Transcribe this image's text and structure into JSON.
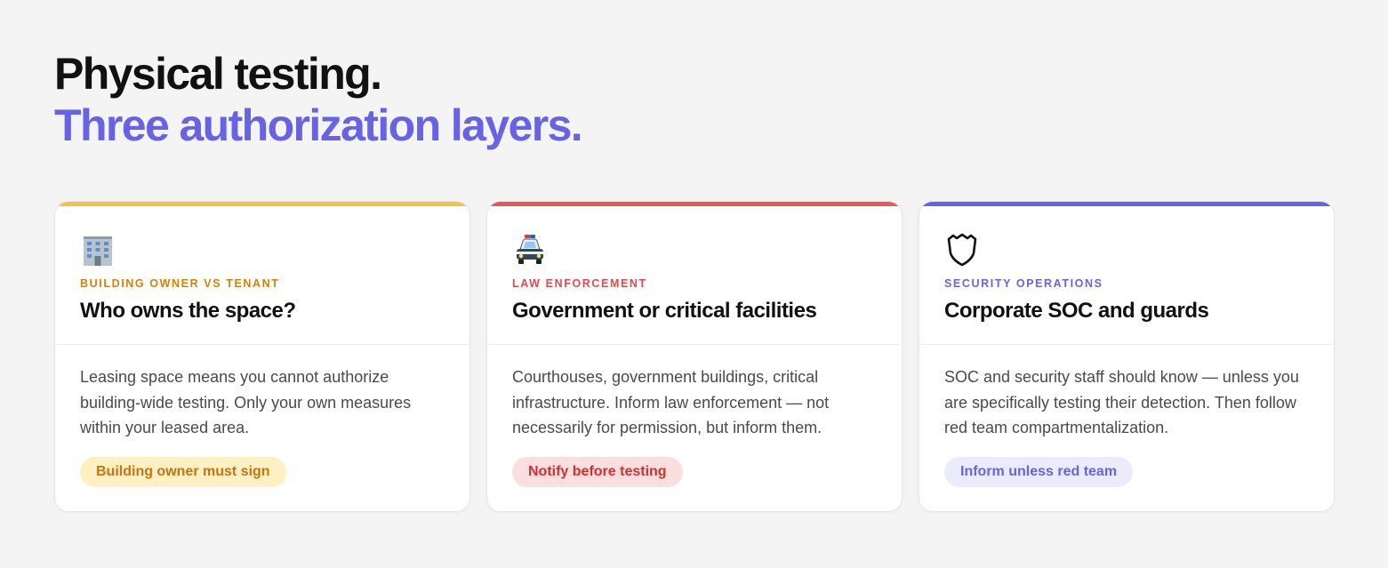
{
  "heading": {
    "line1": "Physical testing.",
    "line2": "Three authorization layers."
  },
  "colors": {
    "accent": "#6663e6",
    "card1_bar": "#f6c244",
    "card2_bar": "#e85757",
    "card3_bar": "#6663e6"
  },
  "cards": [
    {
      "icon": "office-building-icon",
      "eyebrow": "BUILDING OWNER VS TENANT",
      "title": "Who owns the space?",
      "description": "Leasing space means you cannot authorize building-wide testing. Only your own measures within your leased area.",
      "badge": "Building owner must sign"
    },
    {
      "icon": "police-car-icon",
      "eyebrow": "LAW ENFORCEMENT",
      "title": "Government or critical facilities",
      "description": "Courthouses, government buildings, critical infrastructure. Inform law enforcement — not necessarily for permission, but inform them.",
      "badge": "Notify before testing"
    },
    {
      "icon": "shield-icon",
      "eyebrow": "SECURITY OPERATIONS",
      "title": "Corporate SOC and guards",
      "description": "SOC and security staff should know — unless you are specifically testing their detection. Then follow red team compartmentalization.",
      "badge": "Inform unless red team"
    }
  ]
}
